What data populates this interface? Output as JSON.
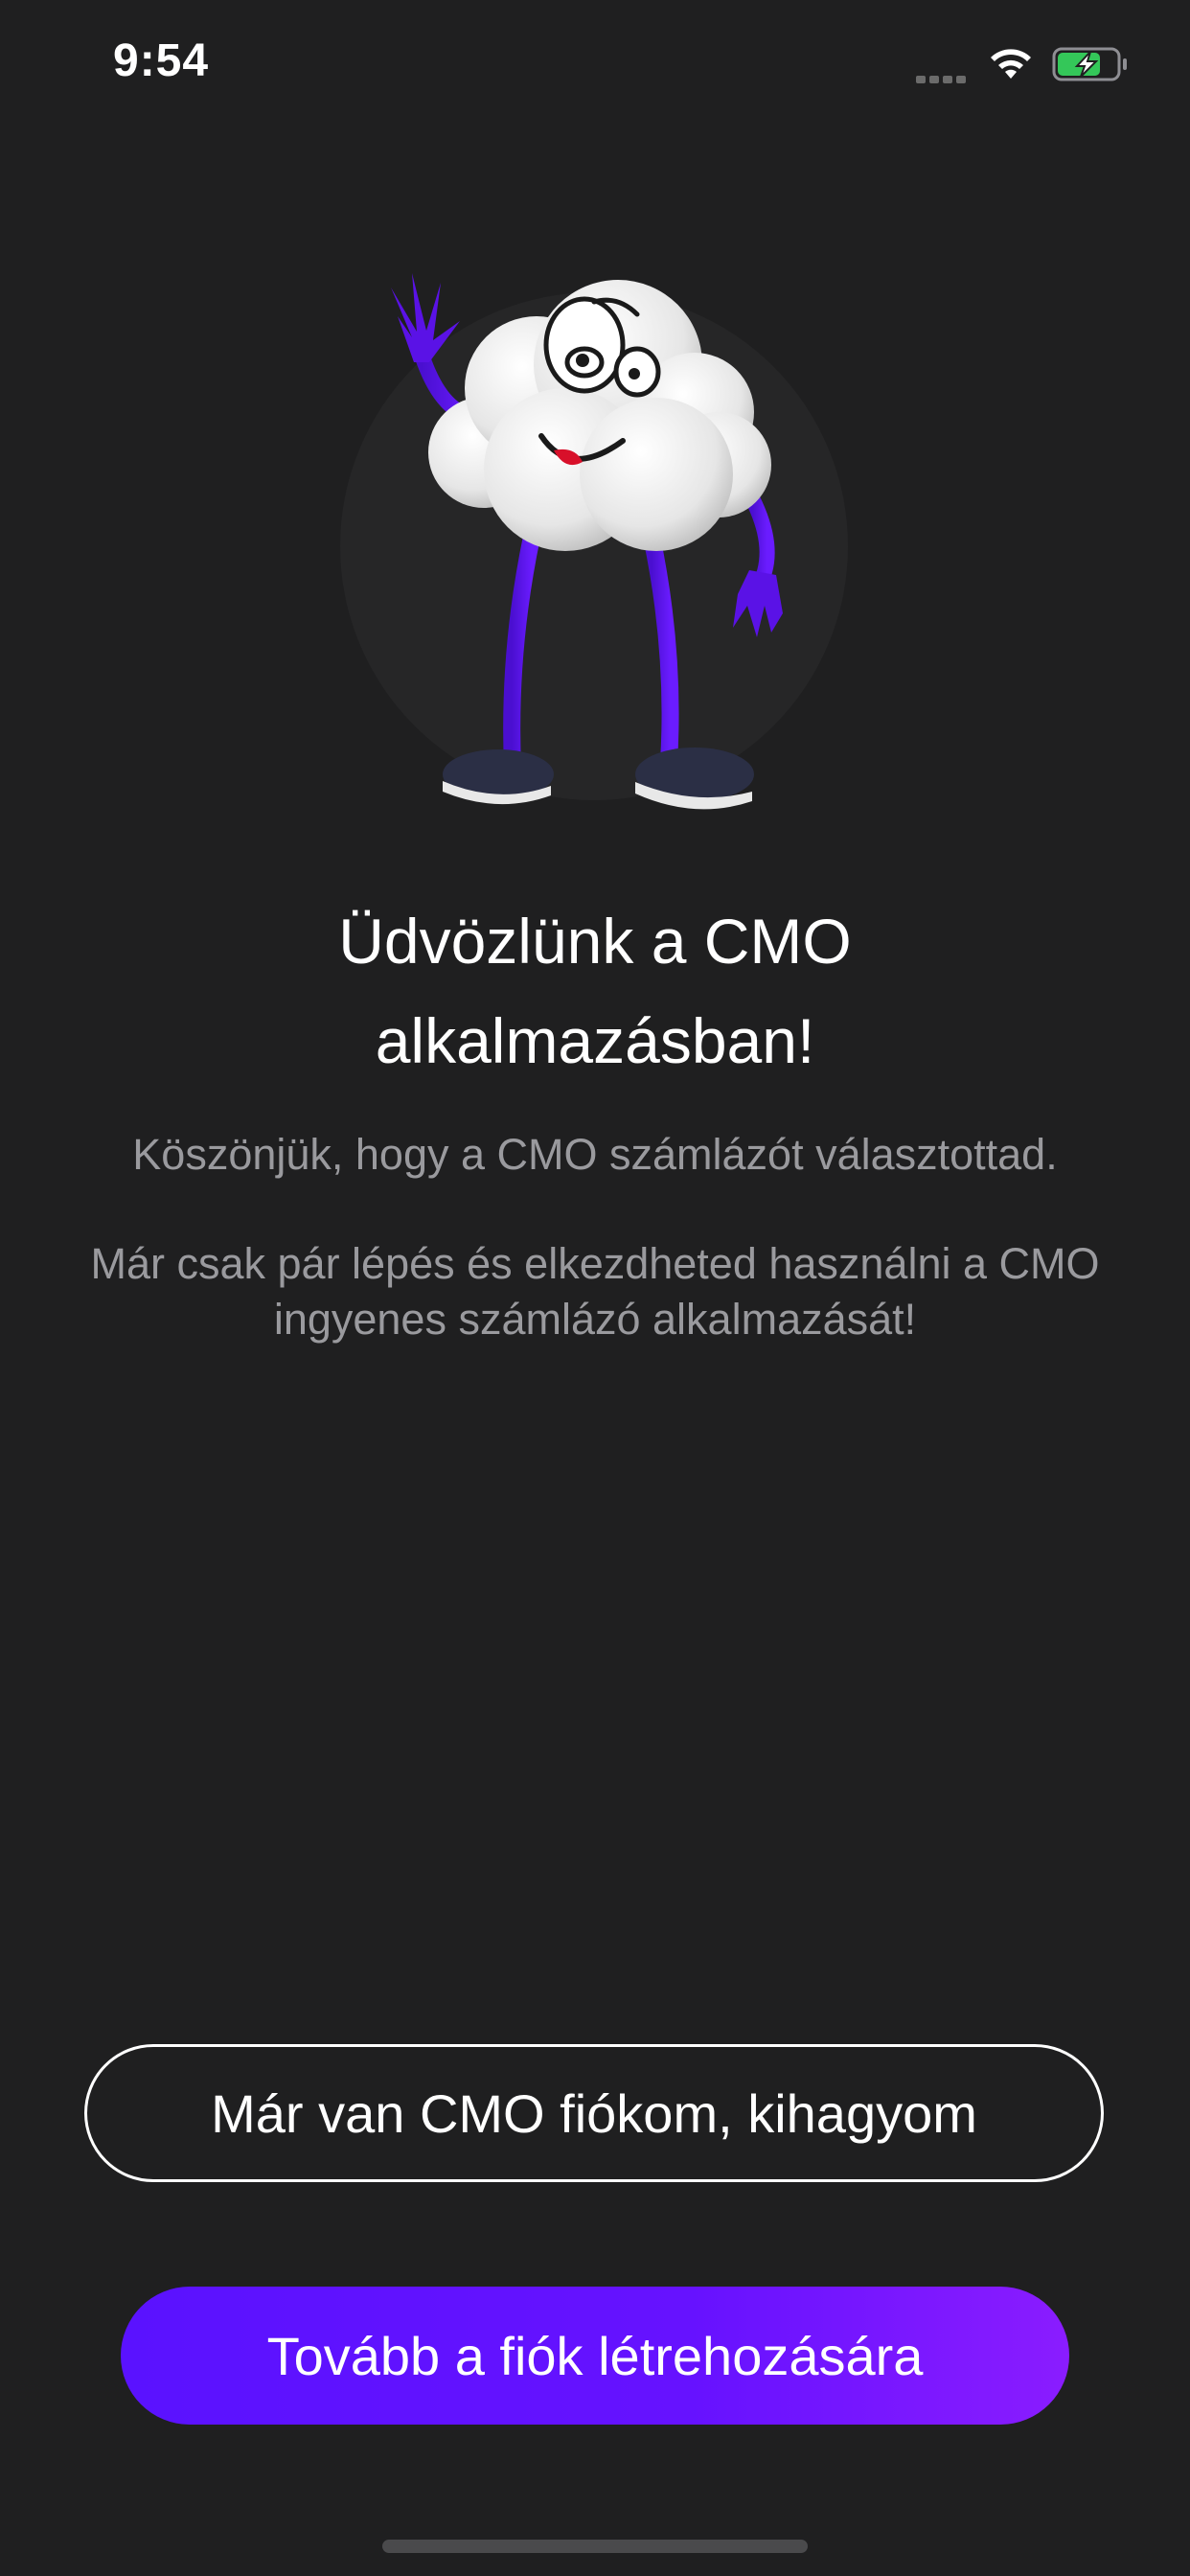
{
  "status_bar": {
    "time": "9:54",
    "icons": [
      "signal-icon",
      "wifi-icon",
      "battery-charging-icon"
    ],
    "battery_color": "#34c759"
  },
  "mascot": {
    "icon": "cloud-mascot-icon",
    "limb_color": "#5a12e6"
  },
  "welcome": {
    "title_line1": "Üdvözlünk a CMO",
    "title_line2": "alkalmazásban!",
    "thanks": "Köszönjük, hogy a CMO számlázót választottad.",
    "steps_line1": "Már csak pár lépés és elkezdheted használni a CMO",
    "steps_line2": "ingyenes számlázó alkalmazását!"
  },
  "buttons": {
    "skip_label": "Már van CMO fiókom, kihagyom",
    "next_label": "Tovább a fiók létrehozására"
  },
  "colors": {
    "background": "#1f1f20",
    "accent": "#6612ff",
    "accent_end": "#8a1cff",
    "secondary_text": "#9a9a9e"
  }
}
